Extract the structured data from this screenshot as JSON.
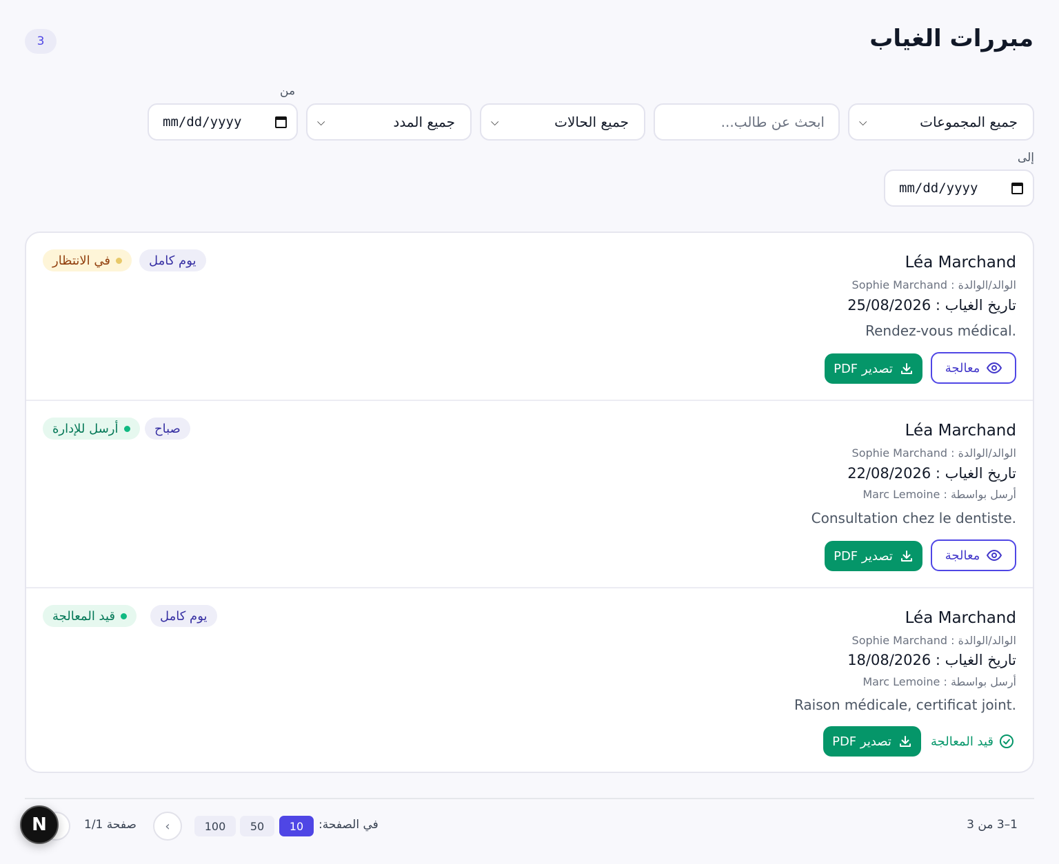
{
  "page": {
    "title": "مبررات الغياب",
    "count": "3"
  },
  "filters": {
    "group": "جميع المجموعات",
    "search_placeholder": "ابحث عن طالب...",
    "status": "جميع الحالات",
    "duration": "جميع المدد",
    "from_label": "من",
    "from_value": "mm/dd/yyyy",
    "to_label": "إلى",
    "to_value": "mm/dd/yyyy"
  },
  "items": [
    {
      "name": "Léa Marchand",
      "parent": "الوالد/الوالدة : Sophie Marchand",
      "date": "تاريخ الغياب : 25/08/2026",
      "sent_by": "",
      "reason": "Rendez-vous médical.",
      "type": "يوم كامل",
      "status": "في الانتظار",
      "export_label": "تصدير PDF",
      "action_label": "معالجة"
    },
    {
      "name": "Léa Marchand",
      "parent": "الوالد/الوالدة : Sophie Marchand",
      "date": "تاريخ الغياب : 22/08/2026",
      "sent_by": "أرسل بواسطة : Marc Lemoine",
      "reason": "Consultation chez le dentiste.",
      "type": "صباح",
      "status": "أرسل للإدارة",
      "export_label": "تصدير PDF",
      "action_label": "معالجة"
    },
    {
      "name": "Léa Marchand",
      "parent": "الوالد/الوالدة : Sophie Marchand",
      "date": "تاريخ الغياب : 18/08/2026",
      "sent_by": "أرسل بواسطة : Marc Lemoine",
      "reason": "Raison médicale, certificat joint.",
      "type": "يوم كامل",
      "status": "قيد المعالجة",
      "export_label": "تصدير PDF",
      "action_label": "قيد المعالجة"
    }
  ],
  "pagination": {
    "range": "1–3 من 3",
    "per_page_label": "في الصفحة:",
    "options": [
      "10",
      "50",
      "100"
    ],
    "selected": "10",
    "page_info": "صفحة 1/1"
  },
  "colors": {
    "primary": "#4f46e5",
    "success": "#059669",
    "warning_bg": "#fef5d8"
  }
}
